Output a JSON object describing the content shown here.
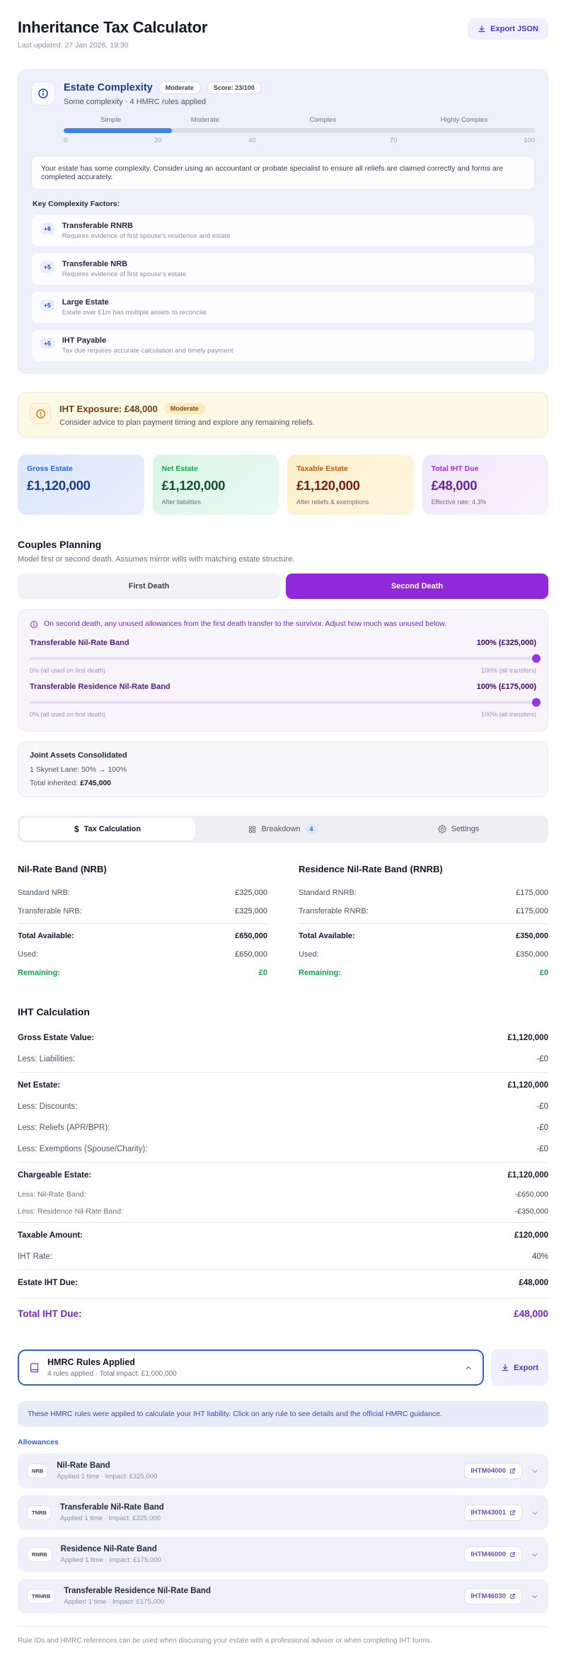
{
  "header": {
    "title": "Inheritance Tax Calculator",
    "last_updated": "Last updated: 27 Jan 2026, 19:30",
    "export_json_label": "Export JSON"
  },
  "complexity": {
    "title": "Estate Complexity",
    "level_badge": "Moderate",
    "score_badge": "Score: 23/100",
    "subtitle": "Some complexity · 4 HMRC rules applied",
    "score_percent": 23,
    "scale_labels": {
      "0": "Simple",
      "1": "Moderate",
      "2": "Complex",
      "3": "Highly Complex"
    },
    "scale_ticks": {
      "0": "0",
      "1": "20",
      "2": "40",
      "3": "70",
      "4": "100"
    },
    "advice": "Your estate has some complexity. Consider using an accountant or probate specialist to ensure all reliefs are claimed correctly and forms are completed accurately.",
    "factors_label": "Key Complexity Factors:",
    "factors": [
      {
        "points": "+8",
        "title": "Transferable RNRB",
        "description": "Requires evidence of first spouse's residence and estate"
      },
      {
        "points": "+5",
        "title": "Transferable NRB",
        "description": "Requires evidence of first spouse's estate"
      },
      {
        "points": "+5",
        "title": "Large Estate",
        "description": "Estate over £1m has multiple assets to reconcile"
      },
      {
        "points": "+5",
        "title": "IHT Payable",
        "description": "Tax due requires accurate calculation and timely payment"
      }
    ]
  },
  "exposure": {
    "title": "IHT Exposure: £48,000",
    "badge": "Moderate",
    "subtitle": "Consider advice to plan payment timing and explore any remaining reliefs."
  },
  "summary_cards": [
    {
      "label": "Gross Estate",
      "value": "£1,120,000",
      "caption": ""
    },
    {
      "label": "Net Estate",
      "value": "£1,120,000",
      "caption": "After liabilities"
    },
    {
      "label": "Taxable Estate",
      "value": "£1,120,000",
      "caption": "After reliefs & exemptions"
    },
    {
      "label": "Total IHT Due",
      "value": "£48,000",
      "caption": "Effective rate: 4.3%"
    }
  ],
  "couples": {
    "title": "Couples Planning",
    "subtitle": "Model first or second death. Assumes mirror wills with matching estate structure.",
    "first_death_label": "First Death",
    "second_death_label": "Second Death",
    "note": "On second death, any unused allowances from the first death transfer to the survivor. Adjust how much was unused below.",
    "sliders": [
      {
        "label": "Transferable Nil-Rate Band",
        "value": "100% (£325,000)",
        "percent": 100,
        "min_label": "0% (all used on first death)",
        "max_label": "100% (all transfers)"
      },
      {
        "label": "Transferable Residence Nil-Rate Band",
        "value": "100% (£175,000)",
        "percent": 100,
        "min_label": "0% (all used on first death)",
        "max_label": "100% (all transfers)"
      }
    ],
    "joint_assets": {
      "title": "Joint Assets Consolidated",
      "line": "1 Skynet Lane: 50% → 100%",
      "total_label": "Total inherited: ",
      "total_value": "£745,000"
    }
  },
  "tabs": [
    {
      "label": "Tax Calculation"
    },
    {
      "label": "Breakdown",
      "badge": "4"
    },
    {
      "label": "Settings"
    }
  ],
  "bands": {
    "nrb": {
      "title": "Nil-Rate Band (NRB)",
      "standard_label": "Standard NRB:",
      "standard_value": "£325,000",
      "transferable_label": "Transferable NRB:",
      "transferable_value": "£325,000",
      "total_label": "Total Available:",
      "total_value": "£650,000",
      "used_label": "Used:",
      "used_value": "£650,000",
      "remaining_label": "Remaining:",
      "remaining_value": "£0"
    },
    "rnrb": {
      "title": "Residence Nil-Rate Band (RNRB)",
      "standard_label": "Standard RNRB:",
      "standard_value": "£175,000",
      "transferable_label": "Transferable RNRB:",
      "transferable_value": "£175,000",
      "total_label": "Total Available:",
      "total_value": "£350,000",
      "used_label": "Used:",
      "used_value": "£350,000",
      "remaining_label": "Remaining:",
      "remaining_value": "£0"
    }
  },
  "iht_calc": {
    "title": "IHT Calculation",
    "rows": [
      {
        "label": "Gross Estate Value:",
        "value": "£1,120,000"
      },
      {
        "label": "Less: Liabilities:",
        "value": "-£0"
      },
      {
        "label": "Net Estate:",
        "value": "£1,120,000"
      },
      {
        "label": "Less: Discounts:",
        "value": "-£0"
      },
      {
        "label": "Less: Reliefs (APR/BPR):",
        "value": "-£0"
      },
      {
        "label": "Less: Exemptions (Spouse/Charity):",
        "value": "-£0"
      },
      {
        "label": "Chargeable Estate:",
        "value": "£1,120,000"
      },
      {
        "label": "Less: Nil-Rate Band:",
        "value": "-£650,000"
      },
      {
        "label": "Less: Residence Nil-Rate Band:",
        "value": "-£350,000"
      },
      {
        "label": "Taxable Amount:",
        "value": "£120,000"
      },
      {
        "label": "IHT Rate:",
        "value": "40%"
      },
      {
        "label": "Estate IHT Due:",
        "value": "£48,000"
      },
      {
        "label": "Total IHT Due:",
        "value": "£48,000"
      }
    ]
  },
  "hmrc": {
    "title": "HMRC Rules Applied",
    "subtitle": "4 rules applied · Total impact: £1,000,000",
    "export_label": "Export",
    "info": "These HMRC rules were applied to calculate your IHT liability. Click on any rule to see details and the official HMRC guidance.",
    "group_label": "Allowances",
    "rules": [
      {
        "code": "NRB",
        "name": "Nil-Rate Band",
        "meta": "Applied 1 time · Impact: £325,000",
        "ref": "IHTM04000"
      },
      {
        "code": "TNRB",
        "name": "Transferable Nil-Rate Band",
        "meta": "Applied 1 time · Impact: £325,000",
        "ref": "IHTM43001"
      },
      {
        "code": "RNRB",
        "name": "Residence Nil-Rate Band",
        "meta": "Applied 1 time · Impact: £175,000",
        "ref": "IHTM46000"
      },
      {
        "code": "TRNRB",
        "name": "Transferable Residence Nil-Rate Band",
        "meta": "Applied 1 time · Impact: £175,000",
        "ref": "IHTM46030"
      }
    ],
    "footer": "Rule IDs and HMRC references can be used when discussing your estate with a professional adviser or when completing IHT forms."
  },
  "colors": {
    "accent_blue": "#3b82f6",
    "accent_purple": "#9333ea",
    "accent_green": "#16a34a",
    "accent_amber": "#c05a10",
    "hmrc_border_blue": "#2f62d9"
  }
}
